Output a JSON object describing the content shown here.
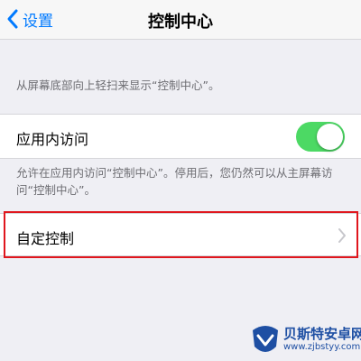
{
  "navbar": {
    "back_label": "设置",
    "title": "控制中心"
  },
  "hint_top": "从屏幕底部向上轻扫来显示“控制中心”。",
  "access_row": {
    "label": "应用内访问",
    "toggle_on": true
  },
  "hint_mid": "允许在应用内访问“控制中心”。停用后，您仍然可以从主屏幕访问“控制中心”。",
  "custom_row": {
    "label": "自定控制"
  },
  "colors": {
    "accent": "#007aff",
    "toggle_on": "#4cd964",
    "highlight": "#e0161d",
    "background": "#efeff4"
  },
  "watermark": {
    "name": "贝斯特安卓网",
    "url": "www.zjbstyy.com"
  }
}
